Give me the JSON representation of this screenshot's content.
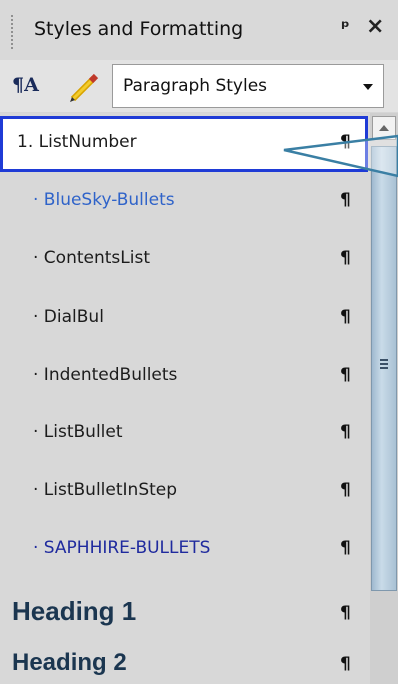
{
  "panel": {
    "title": "Styles and Formatting",
    "pin_glyph": "ᵖ",
    "close_glyph": "×"
  },
  "toolbar": {
    "style_category": "Paragraph Styles",
    "icons": [
      "styles-icon",
      "pencil-icon"
    ]
  },
  "list": {
    "para_mark": "¶",
    "items": [
      {
        "label": "1. ListNumber",
        "color": "#1c1c1c",
        "selected": true
      },
      {
        "label": "· BlueSky-Bullets",
        "color": "#2f63c9"
      },
      {
        "label": "· ContentsList",
        "color": "#1c1c1c"
      },
      {
        "label": "· DialBul",
        "color": "#1c1c1c"
      },
      {
        "label": "· IndentedBullets",
        "color": "#1c1c1c"
      },
      {
        "label": "· ListBullet",
        "color": "#1c1c1c"
      },
      {
        "label": "· ListBulletInStep",
        "color": "#1c1c1c"
      },
      {
        "label": "· SAPHHIRE-BULLETS",
        "color": "#1f2a9e"
      },
      {
        "label": "Heading 1",
        "color": "#1b3650"
      },
      {
        "label": "Heading 2",
        "color": "#1b3650"
      }
    ]
  },
  "colors": {
    "selection_border": "#1f3bd6",
    "callout": "#3a7fa4"
  }
}
